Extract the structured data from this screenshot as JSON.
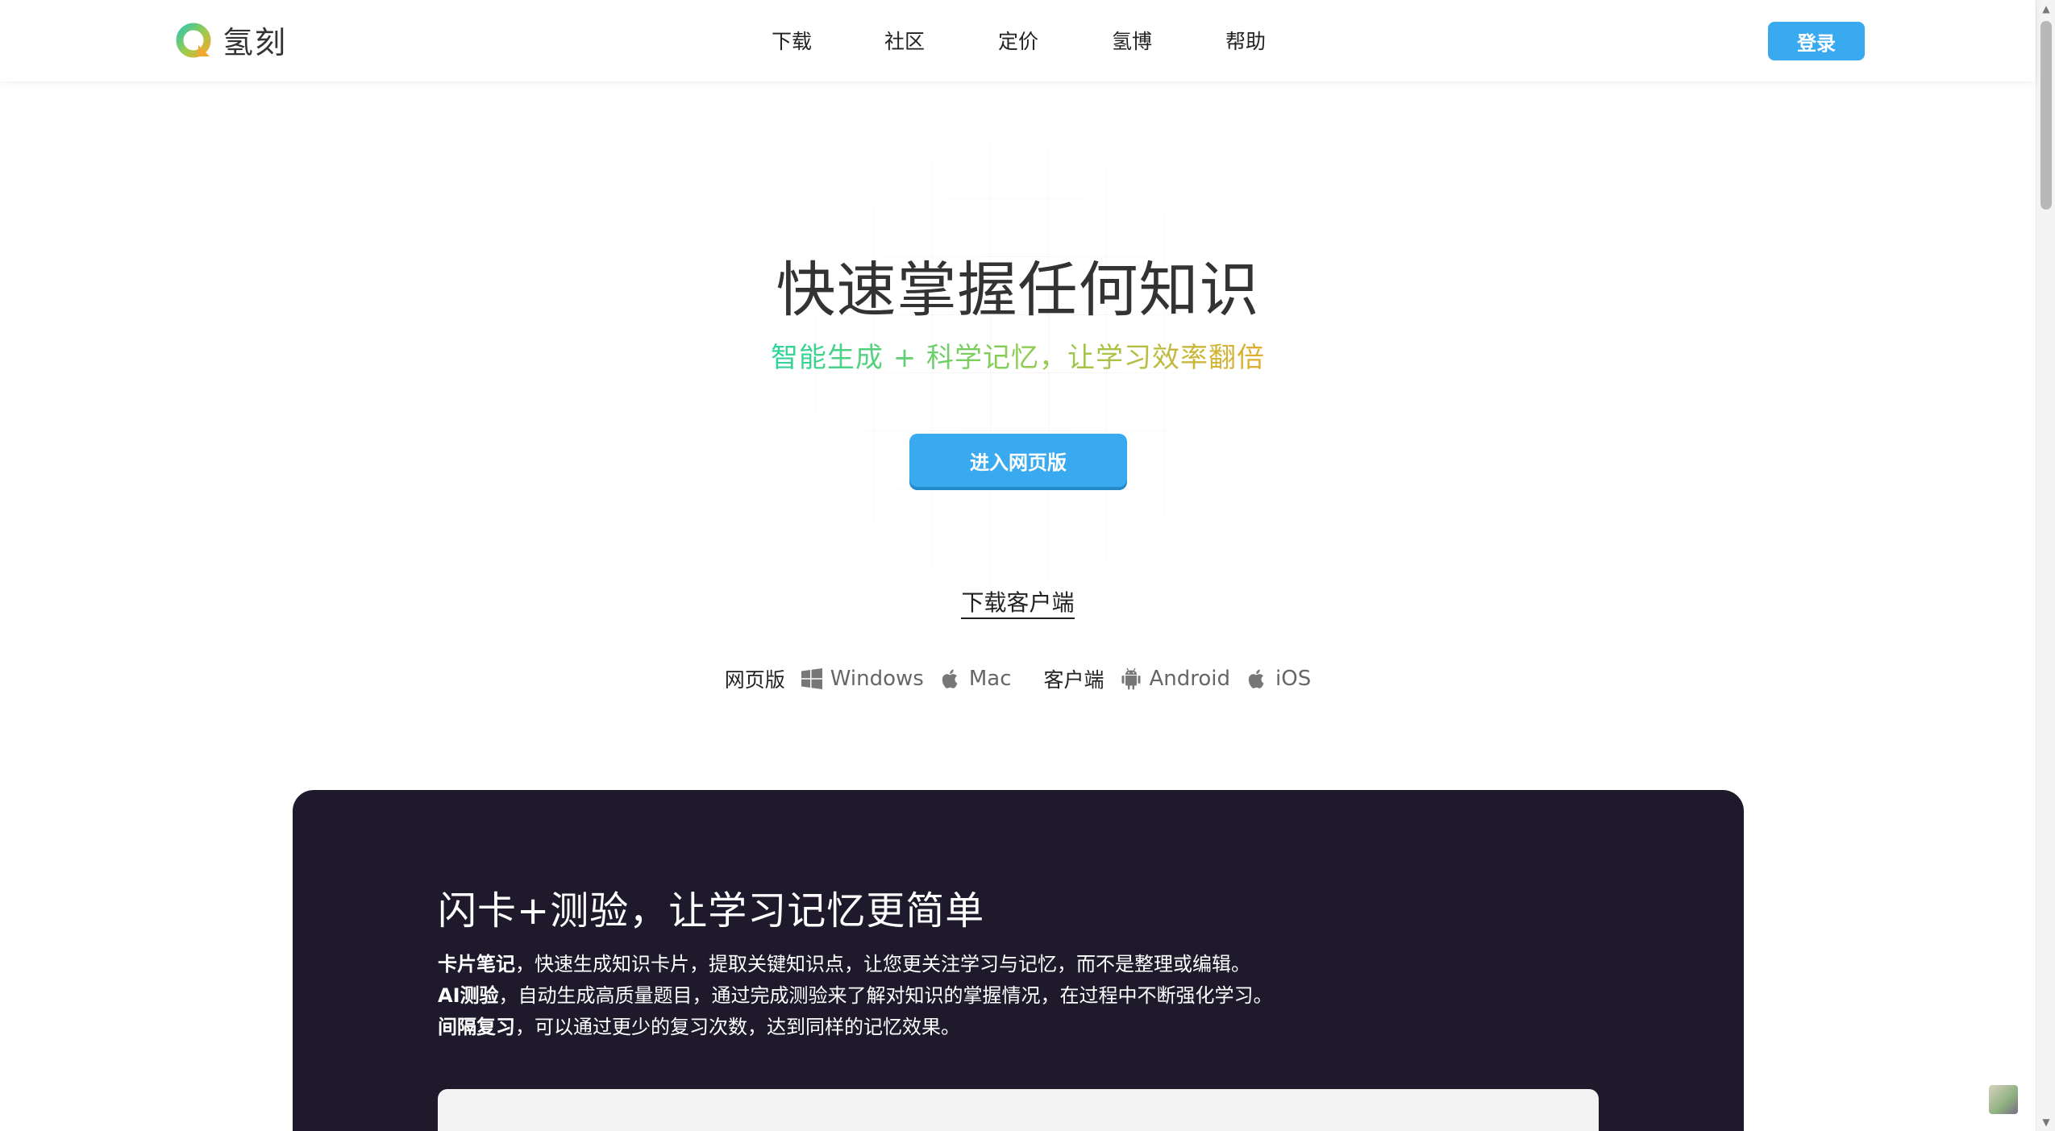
{
  "header": {
    "brand": "氢刻",
    "nav": [
      {
        "label": "下载"
      },
      {
        "label": "社区"
      },
      {
        "label": "定价"
      },
      {
        "label": "氢博"
      },
      {
        "label": "帮助"
      }
    ],
    "login_label": "登录"
  },
  "hero": {
    "title": "快速掌握任何知识",
    "subtitle": "智能生成 + 科学记忆，让学习效率翻倍",
    "cta_label": "进入网页版",
    "download_label": "下载客户端"
  },
  "platforms": {
    "web_label": "网页版",
    "windows": "Windows",
    "mac": "Mac",
    "client_label": "客户端",
    "android": "Android",
    "ios": "iOS"
  },
  "feature": {
    "title": "闪卡+测验，让学习记忆更简单",
    "lines": [
      {
        "bold": "卡片笔记",
        "text": "，快速生成知识卡片，提取关键知识点，让您更关注学习与记忆，而不是整理或编辑。"
      },
      {
        "bold": "AI测验",
        "text": "，自动生成高质量题目，通过完成测验来了解对知识的掌握情况，在过程中不断强化学习。"
      },
      {
        "bold": "间隔复习",
        "text": "，可以通过更少的复习次数，达到同样的记忆效果。"
      }
    ]
  },
  "colors": {
    "accent": "#3aaaf0",
    "dark_section": "#1e1a2c",
    "gradient_start": "#2ed39b",
    "gradient_end": "#e2ad2e"
  }
}
